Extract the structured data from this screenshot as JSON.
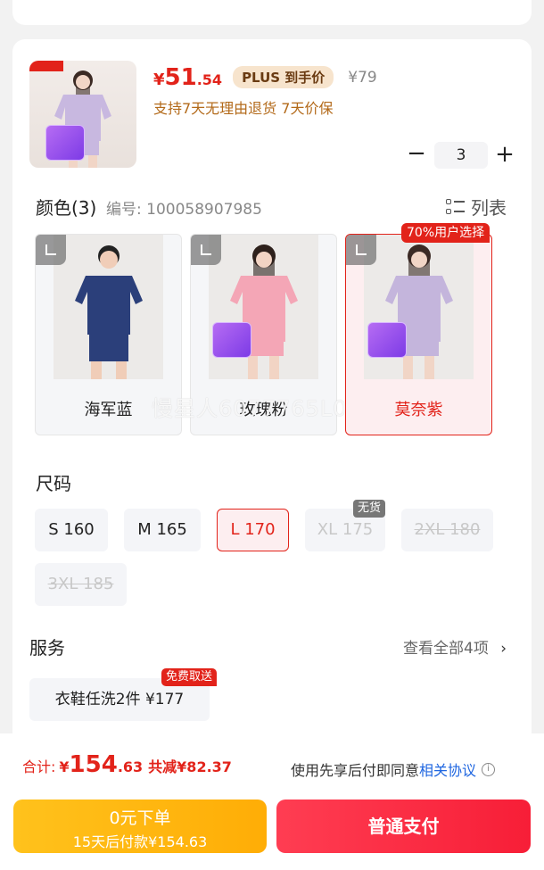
{
  "product": {
    "price_currency": "¥",
    "price_int": "51",
    "price_dec": ".54",
    "plus_badge": "PLUS 到手价",
    "original_price": "¥79",
    "return_policy": "支持7天无理由退货  7天价保",
    "quantity": "3",
    "minus_symbol": "−",
    "plus_symbol": "+"
  },
  "color": {
    "title": "颜色(3)",
    "code": "编号: 100058907985",
    "list_label": "列表",
    "popular_badge": "70%用户选择",
    "options": [
      {
        "label": "海军蓝",
        "shirt_color": "#2b3f7a",
        "selected": false
      },
      {
        "label": "玫瑰粉",
        "shirt_color": "#f4a6b6",
        "selected": false
      },
      {
        "label": "莫奈紫",
        "shirt_color": "#c4b5dc",
        "selected": true
      }
    ]
  },
  "watermark": "慢星人6077765L0",
  "size": {
    "title": "尺码",
    "nogoods_badge": "无货",
    "options": [
      {
        "label": "S 160"
      },
      {
        "label": "M 165"
      },
      {
        "label": "L 170"
      },
      {
        "label": "XL 175"
      },
      {
        "label": "2XL 180"
      },
      {
        "label": "3XL 185"
      }
    ]
  },
  "service": {
    "title": "服务",
    "view_all": "查看全部4项",
    "chevron": "›",
    "chip": "衣鞋任洗2件  ¥177",
    "free_badge": "免费取送"
  },
  "footer": {
    "total_label": "合计:",
    "total_currency": "¥",
    "total_int": "154",
    "total_dec": ".63",
    "saving": "共减¥82.37",
    "agree_prefix": "使用先享后付即同意",
    "agree_link": "相关协议",
    "info_symbol": "i",
    "later_line1": "0元下单",
    "later_line2": "15天后付款¥154.63",
    "pay_label": "普通支付"
  },
  "colors": {
    "accent_red": "#e2231a",
    "plus_gold": "#f7e4cd",
    "link_blue": "#1f66e0"
  }
}
